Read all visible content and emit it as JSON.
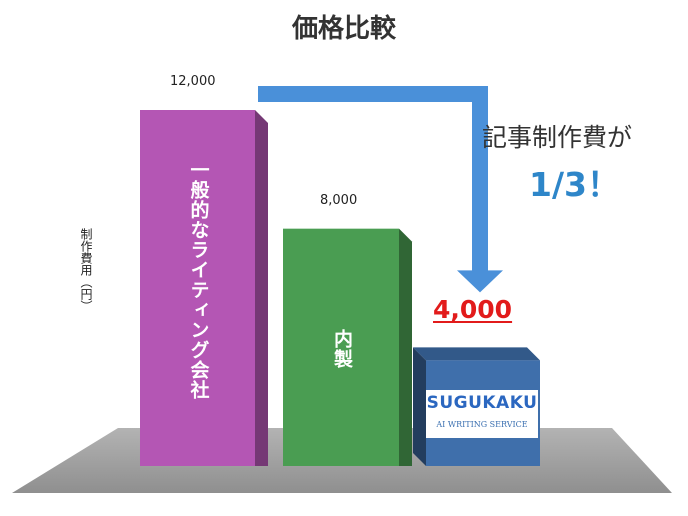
{
  "chart_data": {
    "type": "bar",
    "title": "価格比較",
    "ylabel": "制作費用（円）",
    "categories": [
      "一般的なライティング会社",
      "内製",
      "SUGUKAKU"
    ],
    "values": [
      12000,
      8000,
      4000
    ],
    "value_labels": [
      "12,000",
      "8,000",
      "4,000"
    ],
    "ylim": [
      0,
      12000
    ],
    "grid": false,
    "highlight_index": 2,
    "colors": [
      "#b456b4",
      "#4a9d52",
      "#3f6fab"
    ],
    "highlight_label_color": "#e21b1b",
    "arrow_color": "#4a90d9",
    "annotations": {
      "line1": "記事制作費が",
      "line2": "1/3！"
    },
    "logo": {
      "name": "SUGUKAKU",
      "tagline": "AI WRITING SERVICE"
    }
  }
}
